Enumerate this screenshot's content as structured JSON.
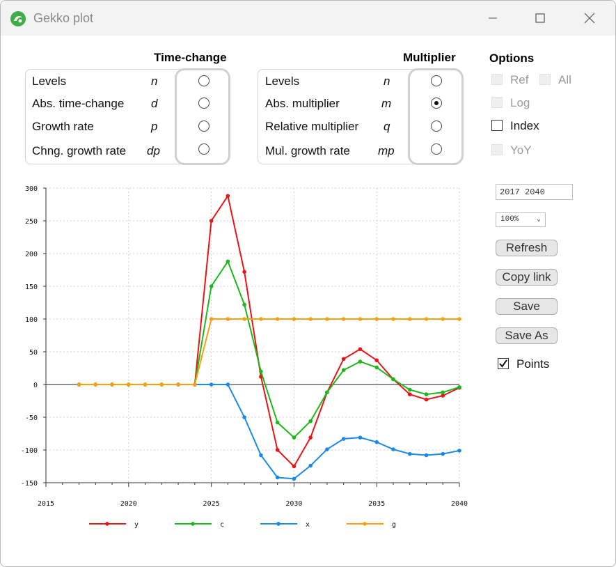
{
  "window": {
    "title": "Gekko plot"
  },
  "time_change": {
    "title": "Time-change",
    "rows": [
      {
        "label": "Levels",
        "code": "n",
        "selected": false
      },
      {
        "label": "Abs. time-change",
        "code": "d",
        "selected": false
      },
      {
        "label": "Growth rate",
        "code": "p",
        "selected": false
      },
      {
        "label": "Chng. growth rate",
        "code": "dp",
        "selected": false
      }
    ]
  },
  "multiplier": {
    "title": "Multiplier",
    "rows": [
      {
        "label": "Levels",
        "code": "n",
        "selected": false
      },
      {
        "label": "Abs. multiplier",
        "code": "m",
        "selected": true
      },
      {
        "label": "Relative multiplier",
        "code": "q",
        "selected": false
      },
      {
        "label": "Mul. growth rate",
        "code": "mp",
        "selected": false
      }
    ]
  },
  "options": {
    "title": "Options",
    "ref": {
      "label": "Ref",
      "enabled": false,
      "checked": false
    },
    "all": {
      "label": "All",
      "enabled": false,
      "checked": false
    },
    "log": {
      "label": "Log",
      "enabled": false,
      "checked": false
    },
    "index": {
      "label": "Index",
      "enabled": true,
      "checked": false
    },
    "yoy": {
      "label": "YoY",
      "enabled": false,
      "checked": false
    }
  },
  "controls": {
    "period": "2017 2040",
    "zoom": "100%",
    "refresh": "Refresh",
    "copy_link": "Copy link",
    "save": "Save",
    "save_as": "Save As",
    "points": {
      "label": "Points",
      "checked": true
    }
  },
  "chart_data": {
    "type": "line",
    "xlim": [
      2015,
      2040
    ],
    "ylim": [
      -150,
      300
    ],
    "xticks": [
      "2015",
      "2020",
      "2025",
      "2030",
      "2035",
      "2040"
    ],
    "yticks": [
      "300",
      "250",
      "200",
      "150",
      "100",
      "50",
      "0",
      "-50",
      "-100",
      "-150"
    ],
    "grid": true,
    "legend_position": "bottom",
    "x": [
      2017,
      2018,
      2019,
      2020,
      2021,
      2022,
      2023,
      2024,
      2025,
      2026,
      2027,
      2028,
      2029,
      2030,
      2031,
      2032,
      2033,
      2034,
      2035,
      2036,
      2037,
      2038,
      2039,
      2040
    ],
    "series": [
      {
        "name": "y",
        "color": "#e81416",
        "values": [
          0,
          0,
          0,
          0,
          0,
          0,
          0,
          0,
          250,
          288,
          172,
          12,
          -100,
          -125,
          -81,
          -12,
          39,
          54,
          37,
          8,
          -15,
          -23,
          -17,
          -5
        ]
      },
      {
        "name": "c",
        "color": "#1cb81c",
        "values": [
          0,
          0,
          0,
          0,
          0,
          0,
          0,
          0,
          150,
          188,
          122,
          20,
          -58,
          -81,
          -56,
          -12,
          22,
          35,
          26,
          8,
          -8,
          -15,
          -12,
          -4
        ]
      },
      {
        "name": "x",
        "color": "#1a8ae6",
        "values": [
          0,
          0,
          0,
          0,
          0,
          0,
          0,
          0,
          0,
          0,
          -50,
          -108,
          -142,
          -144,
          -124,
          -99,
          -83,
          -81,
          -88,
          -99,
          -106,
          -108,
          -106,
          -101
        ]
      },
      {
        "name": "g",
        "color": "#f5a00f",
        "values": [
          0,
          0,
          0,
          0,
          0,
          0,
          0,
          0,
          100,
          100,
          100,
          100,
          100,
          100,
          100,
          100,
          100,
          100,
          100,
          100,
          100,
          100,
          100,
          100
        ]
      }
    ]
  }
}
